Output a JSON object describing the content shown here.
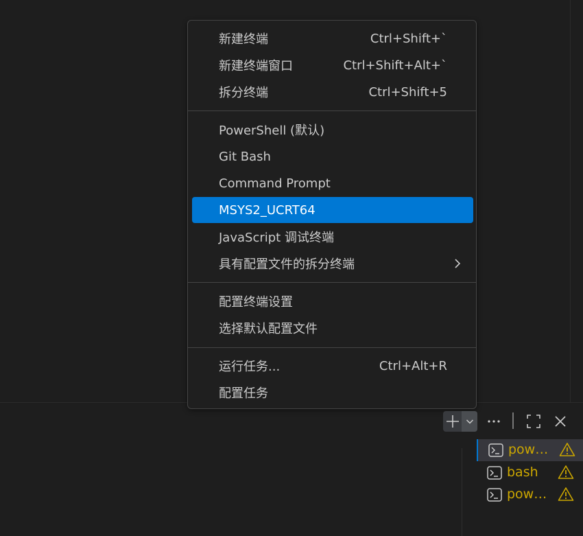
{
  "menu": {
    "groups": [
      [
        {
          "label": "新建终端",
          "shortcut": "Ctrl+Shift+`"
        },
        {
          "label": "新建终端窗口",
          "shortcut": "Ctrl+Shift+Alt+`"
        },
        {
          "label": "拆分终端",
          "shortcut": "Ctrl+Shift+5"
        }
      ],
      [
        {
          "label": "PowerShell (默认)"
        },
        {
          "label": "Git Bash"
        },
        {
          "label": "Command Prompt"
        },
        {
          "label": "MSYS2_UCRT64",
          "selected": true
        },
        {
          "label": "JavaScript 调试终端"
        },
        {
          "label": "具有配置文件的拆分终端",
          "submenu": true
        }
      ],
      [
        {
          "label": "配置终端设置"
        },
        {
          "label": "选择默认配置文件"
        }
      ],
      [
        {
          "label": "运行任务...",
          "shortcut": "Ctrl+Alt+R"
        },
        {
          "label": "配置任务"
        }
      ]
    ]
  },
  "toolbar": {
    "icons": [
      "plus-icon",
      "chevron-down-icon",
      "ellipsis-icon",
      "maximize-icon",
      "close-icon"
    ]
  },
  "terminal_tabs": [
    {
      "label": "powershell",
      "icon": "terminal-icon",
      "status": "warning-icon",
      "selected": true
    },
    {
      "label": "bash",
      "icon": "terminal-icon",
      "status": "warning-icon"
    },
    {
      "label": "powershell",
      "icon": "terminal-icon",
      "status": "warning-icon"
    }
  ],
  "colors": {
    "background": "#1e1e1e",
    "menu_bg": "#1f1f1f",
    "accent": "#0078d4",
    "warning": "#cca700",
    "text": "#cccccc"
  }
}
